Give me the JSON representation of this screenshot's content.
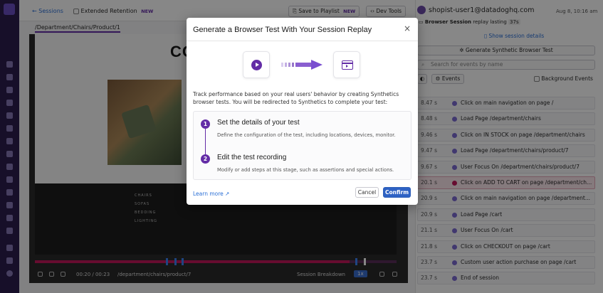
{
  "colors": {
    "accent": "#632ca6",
    "primary_button": "#2e62c4",
    "link": "#2a6fd6",
    "highlight_event": "#fbe6ec"
  },
  "topbar": {
    "back_label": "Sessions",
    "extended_retention_label": "Extended Retention",
    "extended_retention_badge": "NEW",
    "save_playlist_label": "Save to Playlist",
    "save_playlist_badge": "NEW",
    "dev_tools_label": "Dev Tools"
  },
  "user": {
    "email": "shopist-user1@datadoghq.com",
    "timestamp": "Aug 8, 10:16 am"
  },
  "view_tab": "/Department/Chairs/Product/1",
  "player": {
    "brand": "CO",
    "footer_menu": [
      "CHAIRS",
      "SOFAS",
      "BEDDING",
      "LIGHTING"
    ],
    "time": "00:20 / 00:23",
    "url": "/department/chairs/product/7",
    "breakdown_label": "Session Breakdown",
    "speed": "1x",
    "progress": 0.87
  },
  "right_panel": {
    "replay_label": "Browser Session",
    "replay_suffix": "replay lasting",
    "duration": "37s",
    "show_details": "Show session details",
    "generate_test": "Generate Synthetic Browser Test",
    "search_placeholder": "Search for events by name",
    "events_filter": "Events",
    "background_events": "Background Events",
    "events": [
      {
        "time": "8.47 s",
        "text": "Click on main navigation on page /",
        "highlight": false
      },
      {
        "time": "8.48 s",
        "text": "Load Page /department/chairs",
        "highlight": false
      },
      {
        "time": "9.46 s",
        "text": "Click on IN STOCK on page /department/chairs",
        "highlight": false
      },
      {
        "time": "9.47 s",
        "text": "Load Page /department/chairs/product/7",
        "highlight": false
      },
      {
        "time": "9.67 s",
        "text": "User Focus On /department/chairs/product/7",
        "highlight": false
      },
      {
        "time": "20.1 s",
        "text": "Click on ADD TO CART on page /department/ch...",
        "highlight": true
      },
      {
        "time": "20.9 s",
        "text": "Click on main navigation on page /department...",
        "highlight": false
      },
      {
        "time": "20.9 s",
        "text": "Load Page /cart",
        "highlight": false
      },
      {
        "time": "21.1 s",
        "text": "User Focus On /cart",
        "highlight": false
      },
      {
        "time": "21.8 s",
        "text": "Click on CHECKOUT on page /cart",
        "highlight": false
      },
      {
        "time": "23.7 s",
        "text": "Custom user action purchase on page /cart",
        "highlight": false
      },
      {
        "time": "23.7 s",
        "text": "End of session",
        "highlight": false
      }
    ]
  },
  "modal": {
    "title": "Generate a Browser Test With Your Session Replay",
    "description": "Track performance based on your real users' behavior by creating Synthetics browser tests. You will be redirected to Synthetics to complete your test:",
    "steps": [
      {
        "number": "1",
        "title": "Set the details of your test",
        "subtitle": "Define the configuration of the test, including locations, devices, monitor."
      },
      {
        "number": "2",
        "title": "Edit the test recording",
        "subtitle": "Modify or add steps at this stage, such as assertions and special actions."
      }
    ],
    "learn_more": "Learn more",
    "cancel_label": "Cancel",
    "confirm_label": "Confirm",
    "close_icon": "×"
  }
}
